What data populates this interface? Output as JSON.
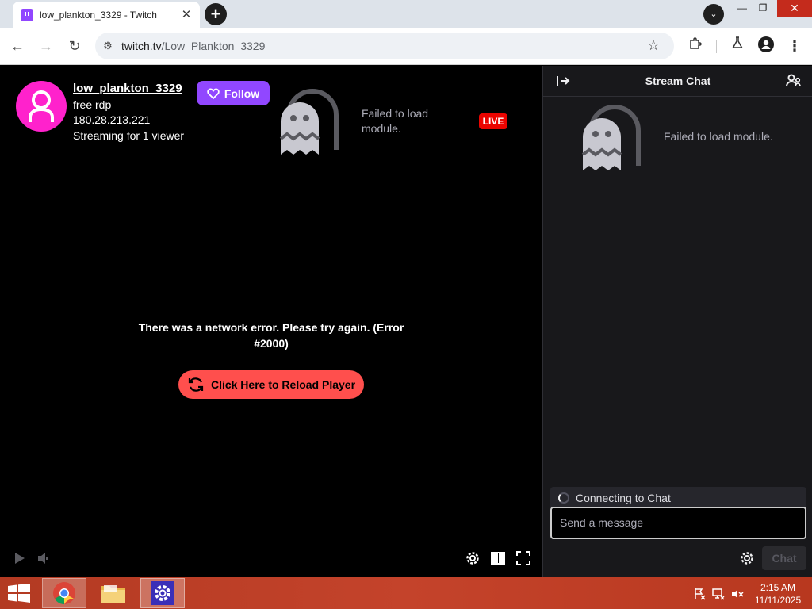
{
  "browser": {
    "tab_title": "low_plankton_3329 - Twitch",
    "url_host": "twitch.tv",
    "url_path": "/Low_Plankton_3329"
  },
  "player": {
    "channel_name": "low_plankton_3329",
    "stream_title": "free rdp",
    "stream_ip": "180.28.213.221",
    "viewers_text": "Streaming for 1 viewer",
    "follow_label": "Follow",
    "module_error": "Failed to load module.",
    "live_badge": "LIVE",
    "network_error": "There was a network error. Please try again. (Error #2000)",
    "reload_label": "Click Here to Reload Player"
  },
  "chat": {
    "title": "Stream Chat",
    "module_error": "Failed to load module.",
    "connecting_text": "Connecting to Chat",
    "input_placeholder": "Send a message",
    "send_label": "Chat"
  },
  "taskbar": {
    "time": "2:15 AM",
    "date": "11/11/2025"
  },
  "colors": {
    "twitch_purple": "#9147ff",
    "live_red": "#eb0400",
    "reload_red": "#ff4f4d",
    "avatar_pink": "#ff22cc",
    "chat_bg": "#18181b"
  },
  "icons": [
    "twitch-favicon",
    "close-icon",
    "plus-icon",
    "chevron-down-icon",
    "back-arrow-icon",
    "forward-arrow-icon",
    "reload-icon",
    "site-info-icon",
    "star-icon",
    "extensions-icon",
    "labs-icon",
    "profile-icon",
    "kebab-menu-icon",
    "heart-icon",
    "ghost-icon",
    "refresh-icon",
    "play-icon",
    "volume-icon",
    "gear-icon",
    "theatre-mode-icon",
    "fullscreen-icon",
    "collapse-icon",
    "users-icon",
    "windows-start-icon",
    "chrome-icon",
    "folder-icon",
    "settings-icon",
    "flag-icon",
    "network-icon",
    "volume-muted-icon"
  ]
}
